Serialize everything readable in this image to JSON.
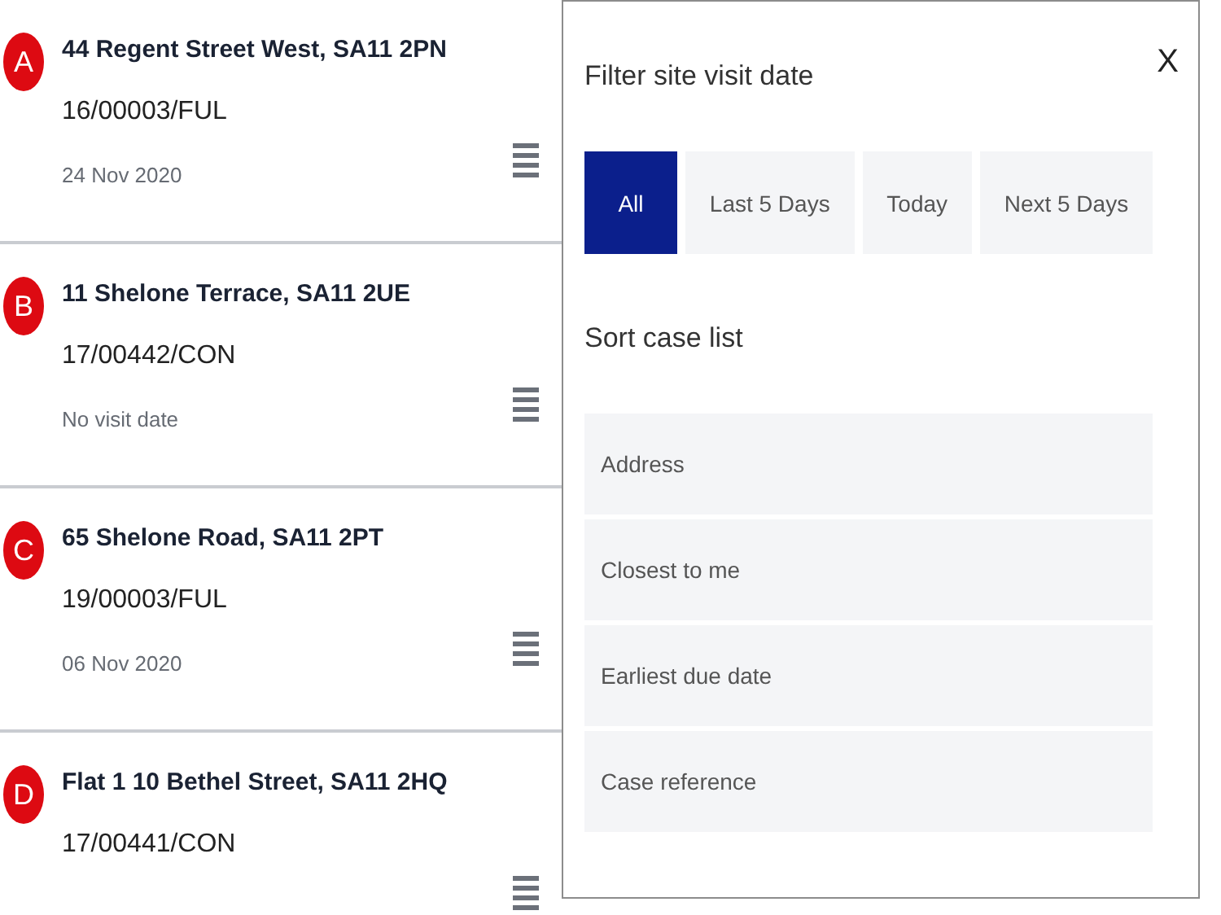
{
  "cases": [
    {
      "marker": "A",
      "address": "44 Regent Street West, SA11 2PN",
      "reference": "16/00003/FUL",
      "visit_date": "24 Nov 2020"
    },
    {
      "marker": "B",
      "address": "11 Shelone Terrace, SA11 2UE",
      "reference": "17/00442/CON",
      "visit_date": "No visit date"
    },
    {
      "marker": "C",
      "address": "65 Shelone Road, SA11 2PT",
      "reference": "19/00003/FUL",
      "visit_date": "06 Nov 2020"
    },
    {
      "marker": "D",
      "address": "Flat 1 10 Bethel Street, SA11 2HQ",
      "reference": "17/00441/CON"
    }
  ],
  "filter_panel": {
    "title": "Filter site visit date",
    "close": "X",
    "filters": [
      {
        "label": "All",
        "selected": true
      },
      {
        "label": "Last 5 Days",
        "selected": false
      },
      {
        "label": "Today",
        "selected": false
      },
      {
        "label": "Next 5 Days",
        "selected": false
      }
    ],
    "sort_title": "Sort case list",
    "sort_options": [
      "Address",
      "Closest to me",
      "Earliest due date",
      "Case reference"
    ]
  }
}
